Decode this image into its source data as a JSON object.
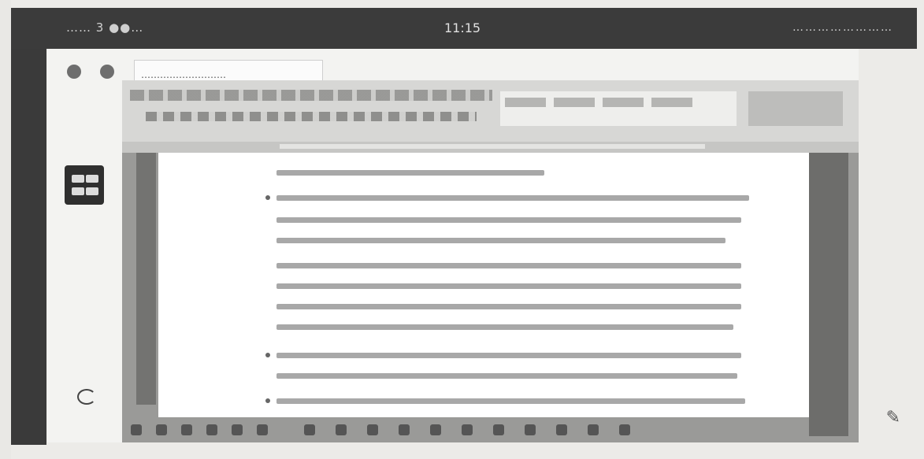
{
  "status_bar": {
    "left": "…… 3 ●●…",
    "clock": "11:15",
    "right": "……………………"
  },
  "window": {
    "tooltip": "………………………"
  },
  "icons": {
    "window_dots": [
      "circle-icon",
      "circle-icon"
    ],
    "app_icon": "grid-icon",
    "corner_icon": "arc-icon",
    "taskbar": [
      "tool-icon",
      "tool-icon",
      "tool-icon",
      "tool-icon",
      "tool-icon",
      "tool-icon",
      "tool-icon",
      "tool-icon",
      "tool-icon",
      "tool-icon",
      "tool-icon",
      "tool-icon",
      "tool-icon",
      "tool-icon",
      "tool-icon",
      "tool-icon",
      "tool-icon"
    ],
    "pen_icon": "pen-icon"
  },
  "colors": {
    "status_bar": "#3b3b3b",
    "page": "#ffffff",
    "app_background": "#9a9a98"
  }
}
